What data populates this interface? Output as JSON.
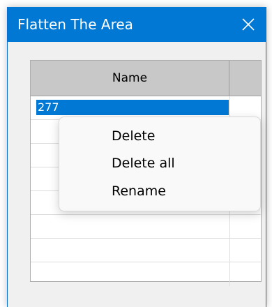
{
  "window": {
    "title": "Flatten The Area",
    "close_icon": "close-icon"
  },
  "grid": {
    "columns": [
      "Name"
    ],
    "rows": [
      {
        "name": "277",
        "selected": true
      },
      {
        "name": ""
      },
      {
        "name": ""
      },
      {
        "name": ""
      },
      {
        "name": ""
      },
      {
        "name": ""
      },
      {
        "name": ""
      },
      {
        "name": ""
      }
    ]
  },
  "context_menu": {
    "items": [
      "Delete",
      "Delete all",
      "Rename"
    ]
  },
  "colors": {
    "titlebar": "#0078d4",
    "selection": "#0078d4"
  }
}
